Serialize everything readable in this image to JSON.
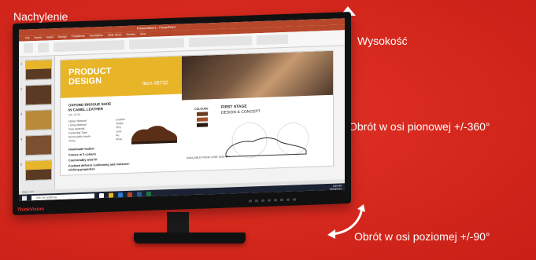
{
  "labels": {
    "tilt": "Nachylenie",
    "height": "Wysokość",
    "pivot": "Obrót w osi pionowej +/-360°",
    "swivel": "Obrót w osi poziomej +/-90°"
  },
  "monitor": {
    "brand": "ThinkVision"
  },
  "powerpoint": {
    "title": "Presentation1 - PowerPoint",
    "tabs": [
      "File",
      "Home",
      "Insert",
      "Design",
      "Transitions",
      "Animations",
      "Slide Show",
      "Review",
      "View"
    ],
    "slide": {
      "title_line1": "PRODUCT",
      "title_line2": "DESIGN",
      "item": "Item #8732",
      "subhead_line1": "OXFORD BROGUE SHOE",
      "subhead_line2": "IN CAMEL LEATHER",
      "ref": "NO. 8732",
      "specs": [
        {
          "k": "Upper Material",
          "v": "Leather"
        },
        {
          "k": "Lining Material",
          "v": "Textile"
        },
        {
          "k": "Sole Material",
          "v": "TPU"
        },
        {
          "k": "Fastening Type",
          "v": "Lace"
        },
        {
          "k": "Removable Insole",
          "v": "No"
        },
        {
          "k": "Trims",
          "v": "None"
        }
      ],
      "bullets": [
        "Handmade leather",
        "Comes in 3 colours",
        "Comfortably wide fit",
        "Footbed delivers cushioning and moisture-wicking properties"
      ],
      "colours_label": "COLOURS",
      "swatches": [
        "#6b3a1f",
        "#a0522d",
        "#2a1a12"
      ],
      "first_stage_line1": "FIRST STAGE",
      "first_stage_line2": "DESIGN & CONCEPT",
      "available": "AVAILABLE FROM JUNE 2019 ON"
    },
    "status": "Slide 1 of 5",
    "taskbar": {
      "search": "Ask me anything",
      "time": "6:30 AM",
      "date": "02/28/2019"
    }
  }
}
